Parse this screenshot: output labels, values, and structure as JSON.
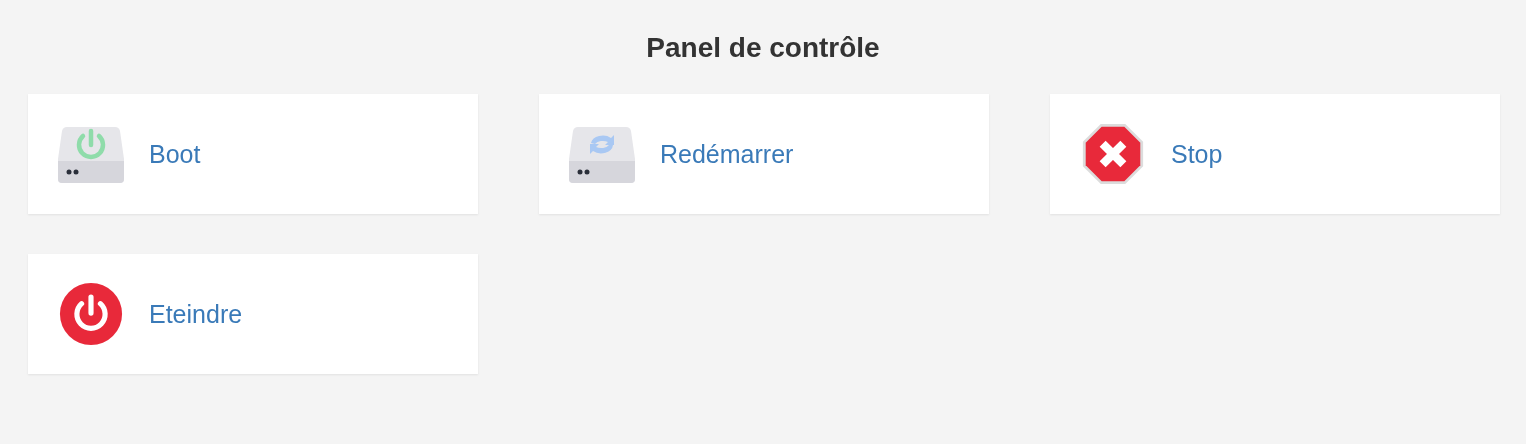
{
  "title": "Panel de contrôle",
  "actions": [
    {
      "label": "Boot",
      "kind": "drive-power"
    },
    {
      "label": "Redémarrer",
      "kind": "drive-refresh"
    },
    {
      "label": "Stop",
      "kind": "stop"
    },
    {
      "label": "Eteindre",
      "kind": "power"
    }
  ]
}
